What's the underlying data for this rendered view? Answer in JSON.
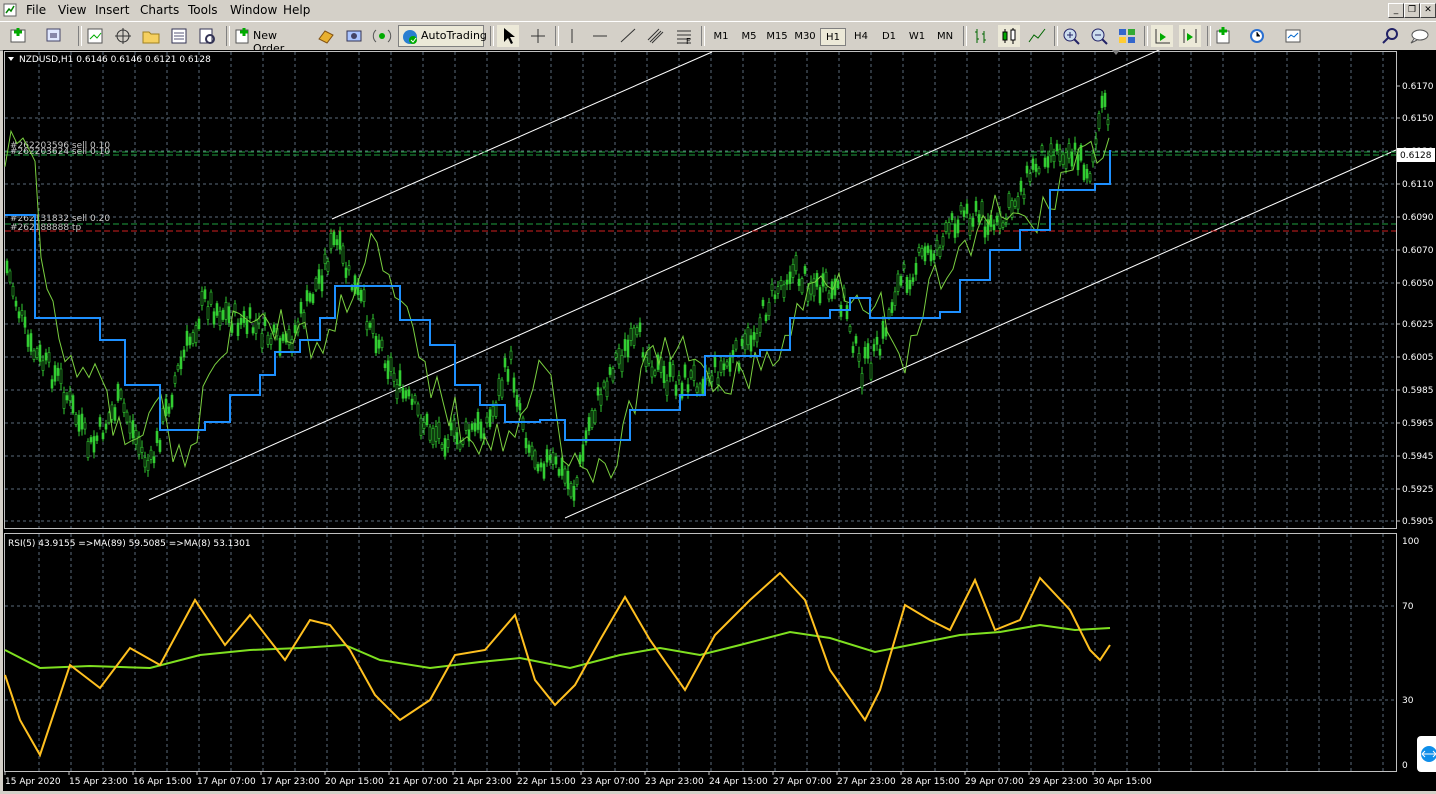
{
  "menu": [
    "File",
    "View",
    "Insert",
    "Charts",
    "Tools",
    "Window",
    "Help"
  ],
  "toolbar": {
    "new_order": "New Order",
    "autotrading": "AutoTrading",
    "timeframes": [
      "M1",
      "M5",
      "M15",
      "M30",
      "H1",
      "H4",
      "D1",
      "W1",
      "MN"
    ],
    "active_timeframe": "H1"
  },
  "chart": {
    "header": "NZDUSD,H1  0.6146 0.6146 0.6121 0.6128",
    "current_price": "0.6128",
    "price_labels": [
      "0.6170",
      "0.6150",
      "0.6130",
      "0.6110",
      "0.6090",
      "0.6070",
      "0.6050",
      "0.6025",
      "0.6005",
      "0.5985",
      "0.5965",
      "0.5945",
      "0.5925",
      "0.5905"
    ],
    "order_lines": {
      "a1": "#262203596 sell 0.10",
      "a2": "#262203624 sell 0.10",
      "b1": "#262131832 sell 0.20",
      "b2": "#262188888 tp"
    },
    "date_labels": [
      "15 Apr 2020",
      "15 Apr 23:00",
      "16 Apr 15:00",
      "17 Apr 07:00",
      "17 Apr 23:00",
      "20 Apr 15:00",
      "21 Apr 07:00",
      "21 Apr 23:00",
      "22 Apr 15:00",
      "23 Apr 07:00",
      "23 Apr 23:00",
      "24 Apr 15:00",
      "27 Apr 07:00",
      "27 Apr 23:00",
      "28 Apr 15:00",
      "29 Apr 07:00",
      "29 Apr 23:00",
      "30 Apr 15:00"
    ]
  },
  "rsi": {
    "header": "RSI(5) 43.9155  =>MA(89) 59.5085  =>MA(8) 53.1301",
    "levels": [
      "100",
      "70",
      "30",
      "0"
    ]
  },
  "colors": {
    "candle": "#32cd32",
    "ma_line": "#1e90ff",
    "rsi_line": "#ffc020",
    "rsi_ma": "#7fe020",
    "grid": "#5a6a7a"
  }
}
